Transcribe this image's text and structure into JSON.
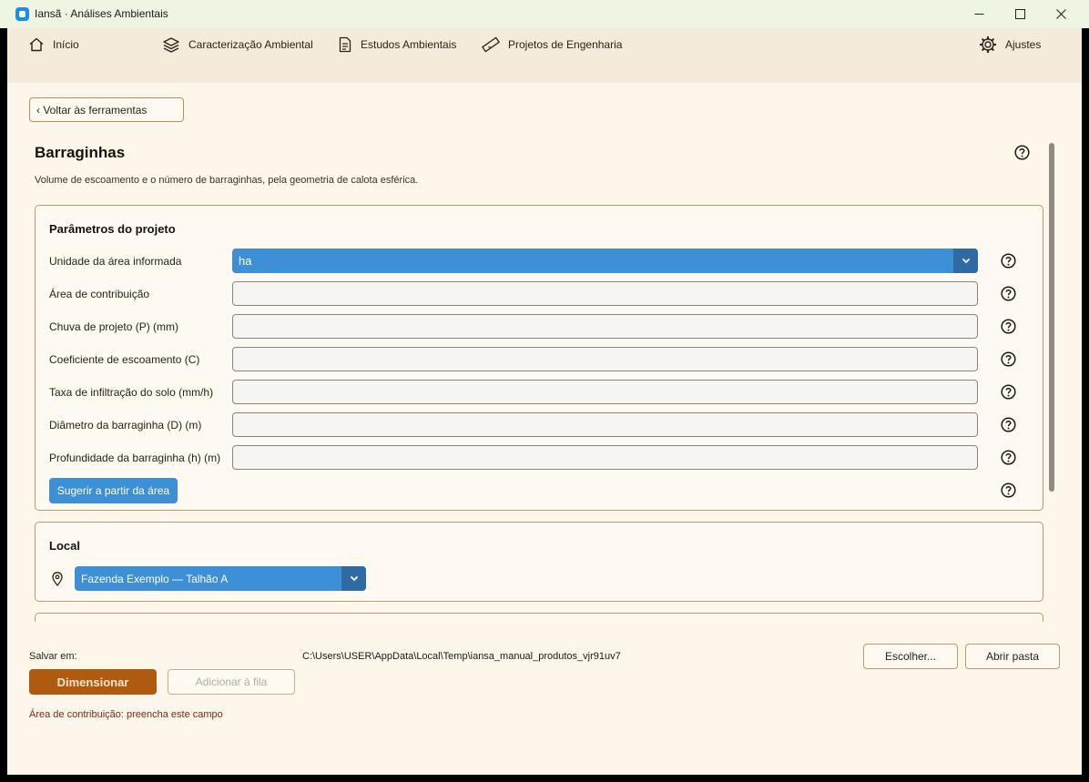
{
  "window": {
    "title": "Iansã · Análises Ambientais",
    "controls": [
      "minimize-icon",
      "maximize-icon",
      "close-icon"
    ]
  },
  "nav": {
    "items": [
      {
        "label": "Início",
        "icon": "home-icon"
      },
      {
        "label": "Caracterização Ambiental",
        "icon": "layers-icon"
      },
      {
        "label": "Estudos Ambientais",
        "icon": "document-icon"
      },
      {
        "label": "Projetos de Engenharia",
        "icon": "ruler-icon"
      }
    ],
    "settings": {
      "label": "Ajustes",
      "icon": "gear-icon"
    }
  },
  "back_button": "‹ Voltar às ferramentas",
  "page": {
    "title": "Barraginhas",
    "subtitle": "Volume de escoamento e o número de barraginhas, pela geometria de calota esférica."
  },
  "params": {
    "title": "Parâmetros do projeto",
    "unit": {
      "label": "Unidade da área informada",
      "value": "ha"
    },
    "fields": [
      {
        "label": "Área de contribuição",
        "value": ""
      },
      {
        "label": "Chuva de projeto (P) (mm)",
        "value": ""
      },
      {
        "label": "Coeficiente de escoamento (C)",
        "value": ""
      },
      {
        "label": "Taxa de infiltração do solo (mm/h)",
        "value": ""
      },
      {
        "label": "Diâmetro da barraginha (D) (m)",
        "value": ""
      },
      {
        "label": "Profundidade da barraginha (h) (m)",
        "value": ""
      }
    ],
    "suggest_button": "Sugerir a partir da área"
  },
  "local": {
    "title": "Local",
    "selected": "Fazenda Exemplo — Talhão A"
  },
  "footer": {
    "save_label": "Salvar em:",
    "save_path": "C:\\Users\\USER\\AppData\\Local\\Temp\\iansa_manual_produtos_vjr91uv7",
    "choose_button": "Escolher...",
    "open_folder_button": "Abrir pasta",
    "dimension_button": "Dimensionar",
    "queue_button": "Adicionar à fila",
    "error": "Área de contribuição: preencha este campo"
  },
  "colors": {
    "accent_blue": "#3d8fd6",
    "primary_brown": "#b05a10",
    "background": "#fdf6ea",
    "error_text": "#7a2a10"
  }
}
